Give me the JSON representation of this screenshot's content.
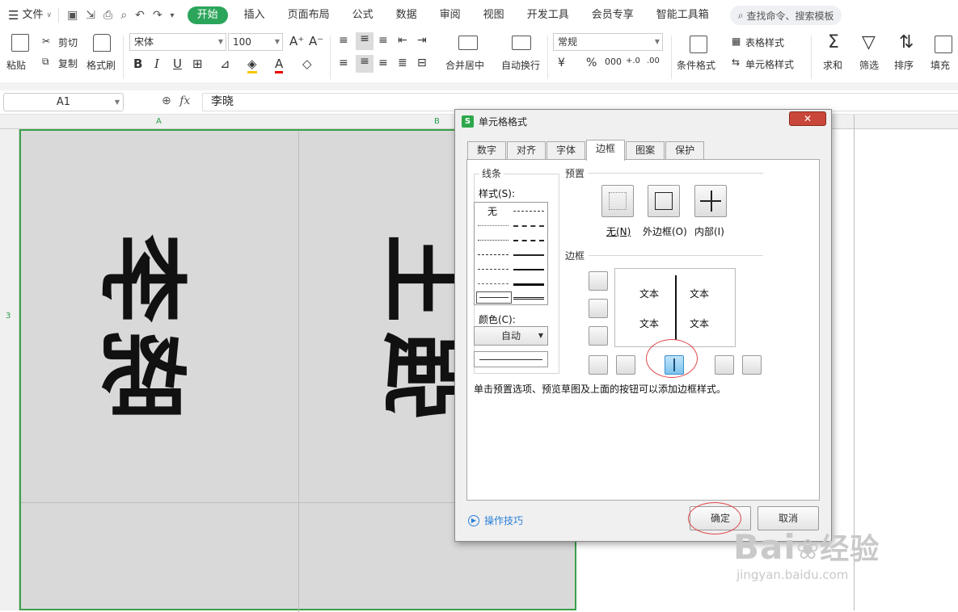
{
  "menubar": {
    "file": "文件",
    "tabs": [
      "开始",
      "插入",
      "页面布局",
      "公式",
      "数据",
      "审阅",
      "视图",
      "开发工具",
      "会员专享",
      "智能工具箱"
    ],
    "search": "查找命令、搜索模板"
  },
  "toolbar": {
    "paste": "粘贴",
    "cut": "剪切",
    "copy": "复制",
    "format_painter": "格式刷",
    "font_name": "宋体",
    "font_size": "100",
    "bold": "B",
    "italic": "I",
    "underline": "U",
    "merge": "合并居中",
    "wrap": "自动换行",
    "number_format": "常规",
    "percent": "%",
    "conditional": "条件格式",
    "table_style": "表格样式",
    "cell_style": "单元格样式",
    "sum": "求和",
    "filter": "筛选",
    "sort": "排序",
    "fill": "填充"
  },
  "formula": {
    "cell_ref": "A1",
    "fx": "fx",
    "value": "李晓"
  },
  "columns": [
    "A",
    "B"
  ],
  "rows": [
    "3"
  ],
  "dialog": {
    "title": "单元格格式",
    "logo": "S",
    "close": "✕",
    "tabs": [
      "数字",
      "对齐",
      "字体",
      "边框",
      "图案",
      "保护"
    ],
    "active_tab": "边框",
    "line_group": "线条",
    "style_label": "样式(S):",
    "style_none": "无",
    "color_label": "颜色(C):",
    "color_value": "自动",
    "preset_group": "预置",
    "presets": [
      "无(N)",
      "外边框(O)",
      "内部(I)"
    ],
    "border_group": "边框",
    "preview_text": [
      "文本",
      "文本",
      "文本",
      "文本"
    ],
    "hint": "单击预置选项、预览草图及上面的按钮可以添加边框样式。",
    "ok": "确定",
    "cancel": "取消",
    "tips": "操作技巧"
  },
  "watermark": {
    "brand": "Bai",
    "brand2": "经验",
    "url": "jingyan.baidu.com"
  }
}
